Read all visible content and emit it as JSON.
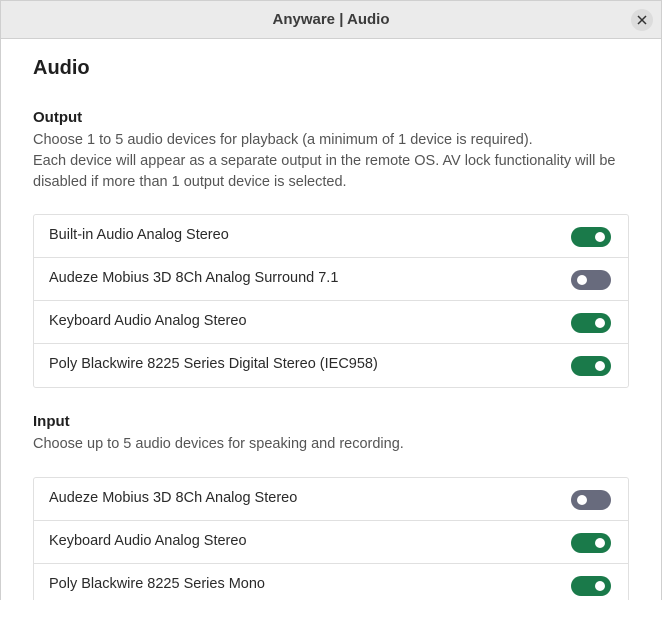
{
  "window": {
    "title": "Anyware | Audio"
  },
  "page": {
    "title": "Audio"
  },
  "output": {
    "heading": "Output",
    "description_line1": "Choose 1 to 5 audio devices for playback (a minimum of 1 device is required).",
    "description_line2": "Each device will appear as a separate output in the remote OS. AV lock functionality will be disabled if more than 1 output device is selected.",
    "devices": [
      {
        "label": "Built-in Audio Analog Stereo",
        "enabled": true
      },
      {
        "label": "Audeze Mobius 3D 8Ch Analog Surround 7.1",
        "enabled": false
      },
      {
        "label": "Keyboard Audio Analog Stereo",
        "enabled": true
      },
      {
        "label": "Poly Blackwire 8225 Series Digital Stereo (IEC958)",
        "enabled": true
      }
    ]
  },
  "input": {
    "heading": "Input",
    "description": "Choose up to 5 audio devices for speaking and recording.",
    "devices": [
      {
        "label": "Audeze Mobius 3D 8Ch Analog Stereo",
        "enabled": false
      },
      {
        "label": "Keyboard Audio Analog Stereo",
        "enabled": true
      },
      {
        "label": "Poly Blackwire 8225 Series Mono",
        "enabled": true
      }
    ]
  },
  "colors": {
    "toggle_on": "#1a7a4a",
    "toggle_off": "#686b7d"
  },
  "icons": {
    "close": "close-icon"
  }
}
